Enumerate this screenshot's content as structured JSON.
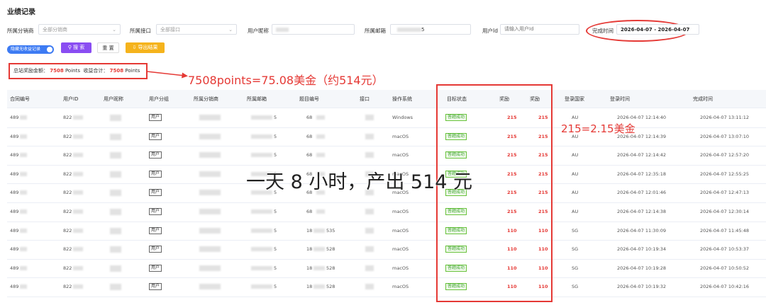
{
  "page_title": "业绩记录",
  "filters": {
    "distributor_label": "所属分销商",
    "distributor_value": "全部分销商",
    "interface_label": "所属接口",
    "interface_value": "全部接口",
    "nickname_label": "用户昵称",
    "email_label": "所属邮箱",
    "email_suffix": "5",
    "userid_label": "用户Id",
    "userid_placeholder": "请输入用户Id",
    "time_label": "完成时间",
    "time_value": "2026-04-07 - 2026-04-07"
  },
  "toolbar": {
    "toggle_label": "隐藏无收益记录",
    "search_label": "搜 索",
    "reset_label": "重 置",
    "export_label": "导出结果"
  },
  "summary": {
    "total_label": "总站奖励金额：",
    "total_value": "7508",
    "unit1": "Points",
    "income_label": "收益合计：",
    "income_value": "7508",
    "unit2": "Points"
  },
  "annotations": {
    "points_note": "7508points=75.08美金（约514元）",
    "reward_note": "215=2.15美金",
    "overlay": "一天 8 小时，产出 514 元"
  },
  "table": {
    "headers": [
      "合同编号",
      "用户ID",
      "用户昵称",
      "用户分组",
      "所属分销商",
      "所属邮箱",
      "题目编号",
      "接口",
      "操作系统",
      "目标状态",
      "奖励",
      "奖励",
      "登录国家",
      "登录时间",
      "完成时间"
    ],
    "rows": [
      {
        "contract": "489",
        "uid": "822",
        "group": "用户",
        "email": "5",
        "qid": "68",
        "os": "Windows",
        "status": "答题成功",
        "reward1": "215",
        "reward2": "215",
        "country": "AU",
        "login": "2026-04-07 12:14:40",
        "done": "2026-04-07 13:11:12"
      },
      {
        "contract": "489",
        "uid": "822",
        "group": "用户",
        "email": "5",
        "qid": "68",
        "os": "macOS",
        "status": "答题成功",
        "reward1": "215",
        "reward2": "215",
        "country": "AU",
        "login": "2026-04-07 12:14:39",
        "done": "2026-04-07 13:07:10"
      },
      {
        "contract": "489",
        "uid": "822",
        "group": "用户",
        "email": "5",
        "qid": "68",
        "os": "macOS",
        "status": "答题成功",
        "reward1": "215",
        "reward2": "215",
        "country": "AU",
        "login": "2026-04-07 12:14:42",
        "done": "2026-04-07 12:57:20"
      },
      {
        "contract": "489",
        "uid": "822",
        "group": "用户",
        "email": "5",
        "qid": "68",
        "os": "macOS",
        "status": "答题成功",
        "reward1": "215",
        "reward2": "215",
        "country": "AU",
        "login": "2026-04-07 12:35:18",
        "done": "2026-04-07 12:55:25"
      },
      {
        "contract": "489",
        "uid": "822",
        "group": "用户",
        "email": "5",
        "qid": "68",
        "os": "macOS",
        "status": "答题成功",
        "reward1": "215",
        "reward2": "215",
        "country": "AU",
        "login": "2026-04-07 12:01:46",
        "done": "2026-04-07 12:47:13"
      },
      {
        "contract": "489",
        "uid": "822",
        "group": "用户",
        "email": "5",
        "qid": "68",
        "os": "macOS",
        "status": "答题成功",
        "reward1": "215",
        "reward2": "215",
        "country": "AU",
        "login": "2026-04-07 12:14:38",
        "done": "2026-04-07 12:30:14"
      },
      {
        "contract": "489",
        "uid": "822",
        "group": "用户",
        "email": "5",
        "qid": "18",
        "qid_suffix": "535",
        "os": "macOS",
        "status": "答题成功",
        "reward1": "110",
        "reward2": "110",
        "country": "SG",
        "login": "2026-04-07 11:30:09",
        "done": "2026-04-07 11:45:48"
      },
      {
        "contract": "489",
        "uid": "822",
        "group": "用户",
        "email": "5",
        "qid": "18",
        "qid_suffix": "528",
        "os": "macOS",
        "status": "答题成功",
        "reward1": "110",
        "reward2": "110",
        "country": "SG",
        "login": "2026-04-07 10:19:34",
        "done": "2026-04-07 10:53:37"
      },
      {
        "contract": "489",
        "uid": "822",
        "group": "用户",
        "email": "5",
        "qid": "18",
        "qid_suffix": "528",
        "os": "macOS",
        "status": "答题成功",
        "reward1": "110",
        "reward2": "110",
        "country": "SG",
        "login": "2026-04-07 10:19:28",
        "done": "2026-04-07 10:50:52"
      },
      {
        "contract": "489",
        "uid": "822",
        "group": "用户",
        "email": "5",
        "qid": "18",
        "qid_suffix": "528",
        "os": "macOS",
        "status": "答题成功",
        "reward1": "110",
        "reward2": "110",
        "country": "SG",
        "login": "2026-04-07 10:19:32",
        "done": "2026-04-07 10:42:16"
      }
    ]
  },
  "colors": {
    "accent": "#3d7bf3",
    "search_button": "#8a4df2",
    "export_button": "#f5b31c",
    "highlight": "#e53935",
    "success": "#67c23a"
  },
  "icons": {
    "search": "search-icon",
    "reset": "reset-icon",
    "export": "export-icon",
    "chevron": "chevron-down-icon",
    "calendar": "calendar-icon"
  }
}
